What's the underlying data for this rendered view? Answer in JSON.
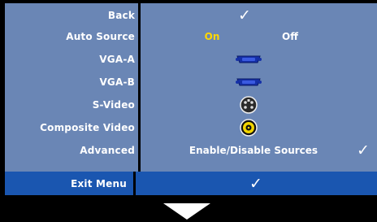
{
  "menu": {
    "back": {
      "label": "Back",
      "value": "✓"
    },
    "auto_source": {
      "label": "Auto Source",
      "on": "On",
      "off": "Off"
    },
    "vga_a": {
      "label": "VGA-A",
      "icon": "vga-connector-icon"
    },
    "vga_b": {
      "label": "VGA-B",
      "icon": "vga-connector-icon"
    },
    "s_video": {
      "label": "S-Video",
      "icon": "s-video-connector-icon"
    },
    "composite_video": {
      "label": "Composite Video",
      "icon": "composite-video-connector-icon"
    },
    "advanced": {
      "label": "Advanced",
      "value": "Enable/Disable Sources",
      "check": "✓"
    },
    "exit_menu": {
      "label": "Exit Menu",
      "check": "✓"
    }
  },
  "colors": {
    "panel": "#6a86b5",
    "selected_row": "#1a56b0",
    "on_highlight": "#ffd700",
    "background": "#000000"
  }
}
